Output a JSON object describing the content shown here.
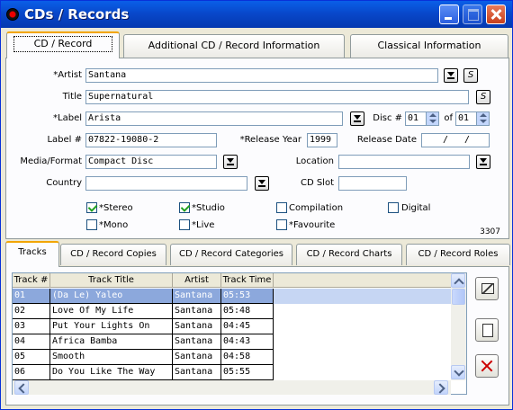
{
  "window": {
    "title": "CDs / Records"
  },
  "top_tabs": [
    "CD / Record",
    "Additional CD / Record Information",
    "Classical Information"
  ],
  "form": {
    "artist_label": "*Artist",
    "artist": "Santana",
    "title_label": "Title",
    "title": "Supernatural",
    "label_label": "*Label",
    "label": "Arista",
    "disc_label": "Disc #",
    "disc": "01",
    "of_label": "of",
    "disc_of": "01",
    "label_num_label": "Label #",
    "label_num": "07822-19080-2",
    "release_year_label": "*Release Year",
    "release_year": "1999",
    "release_date_label": "Release Date",
    "release_date": "/   /",
    "media_label": "Media/Format",
    "media": "Compact Disc",
    "location_label": "Location",
    "location": "",
    "country_label": "Country",
    "country": "",
    "cd_slot_label": "CD Slot",
    "cd_slot": "",
    "s_button": "S",
    "checkboxes": [
      {
        "label": "*Stereo",
        "checked": true
      },
      {
        "label": "*Studio",
        "checked": true
      },
      {
        "label": "Compilation",
        "checked": false
      },
      {
        "label": "Digital",
        "checked": false
      },
      {
        "label": "*Mono",
        "checked": false
      },
      {
        "label": "*Live",
        "checked": false
      },
      {
        "label": "*Favourite",
        "checked": false
      }
    ],
    "record_id": "3307"
  },
  "bottom_tabs": [
    "Tracks",
    "CD / Record Copies",
    "CD / Record Categories",
    "CD / Record Charts",
    "CD / Record Roles"
  ],
  "tracks": {
    "columns": [
      "Track #",
      "Track Title",
      "Artist",
      "Track Time"
    ],
    "rows": [
      [
        "01",
        "(Da Le) Yaleo",
        "Santana",
        "05:53"
      ],
      [
        "02",
        "Love Of My Life",
        "Santana",
        "05:48"
      ],
      [
        "03",
        "Put Your Lights On",
        "Santana",
        "04:45"
      ],
      [
        "04",
        "Africa Bamba",
        "Santana",
        "04:43"
      ],
      [
        "05",
        "Smooth",
        "Santana",
        "04:58"
      ],
      [
        "06",
        "Do You Like The Way",
        "Santana",
        "05:55"
      ]
    ],
    "selected_row": 0
  },
  "side_buttons": [
    "chart-icon",
    "new-document-icon",
    "delete-icon"
  ],
  "colors": {
    "titlebar": "#0846c8",
    "selection": "#8ca8dc",
    "tab_highlight": "#f2a500"
  }
}
